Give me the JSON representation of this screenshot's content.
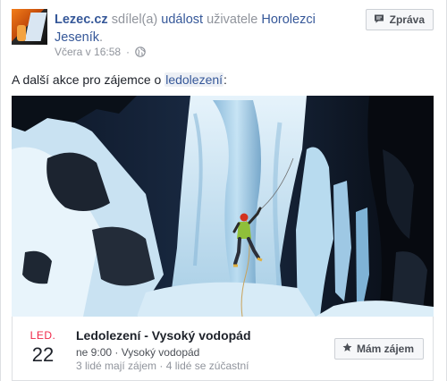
{
  "header": {
    "page_name": "Lezec.cz",
    "action_text": "sdílel(a)",
    "event_link": "událost",
    "owner_prefix": "uživatele",
    "owner_name": "Horolezci Jeseník",
    "owner_suffix": ".",
    "timestamp": "Včera v 16:58",
    "message_button": "Zpráva"
  },
  "post": {
    "text": "A další akce pro zájemce o",
    "tag": "ledolezení",
    "suffix": ":"
  },
  "event": {
    "month": "LED.",
    "day": "22",
    "title": "Ledolezení - Vysoký vodopád",
    "time": "ne 9:00",
    "location": "Vysoký vodopád",
    "interested": "3 lidé mají zájem",
    "going": "4 lidé se zúčastní",
    "interest_button": "Mám zájem"
  },
  "colors": {
    "link": "#365899",
    "month_red": "#f02849",
    "muted": "#90949c"
  }
}
